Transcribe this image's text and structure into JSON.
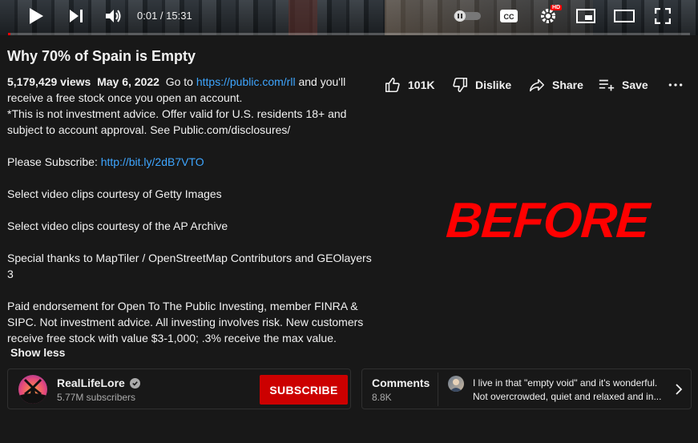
{
  "player": {
    "time": "0:01 / 15:31",
    "progress_fraction": 0.001,
    "hd_badge": "HD",
    "icons": [
      "play-icon",
      "next-icon",
      "volume-icon",
      "autoplay-toggle-icon",
      "captions-icon",
      "settings-icon",
      "miniplayer-icon",
      "theater-icon",
      "fullscreen-icon"
    ]
  },
  "video": {
    "title": "Why 70% of Spain is Empty"
  },
  "description": {
    "views": "5,179,429 views",
    "date": "May 6, 2022",
    "line1_pre": "Go to",
    "line1_link": "https://public.com/rll",
    "line1_post": "and you'll",
    "line2": "receive a free stock once you open an account.",
    "line3": "*This is not investment advice. Offer valid for U.S. residents 18+ and",
    "line4": "subject to account approval. See Public.com/disclosures/",
    "subscribe_pre": "Please Subscribe:",
    "subscribe_link": "http://bit.ly/2dB7VTO",
    "getty": "Select video clips courtesy of Getty Images",
    "ap": "Select video clips courtesy of the AP Archive",
    "thanks_line1": "Special thanks to MapTiler / OpenStreetMap Contributors and GEOlayers",
    "thanks_line2": "3",
    "paid_line1": "Paid endorsement for Open To The Public Investing, member FINRA &",
    "paid_line2": "SIPC. Not investment advice. All investing involves risk. New customers",
    "paid_line3": "receive free stock with value $3-1,000; .3% receive the max value.",
    "show_less": "Show less"
  },
  "actions": {
    "like_count": "101K",
    "dislike_label": "Dislike",
    "share_label": "Share",
    "save_label": "Save"
  },
  "overlay": {
    "before_text": "BEFORE",
    "color": "#ff0000"
  },
  "channel": {
    "name": "RealLifeLore",
    "subscribers": "5.77M subscribers",
    "subscribe_label": "SUBSCRIBE",
    "subscribe_color": "#cc0000"
  },
  "comments": {
    "label": "Comments",
    "count": "8.8K",
    "preview_line1": "I live in that \"empty void\" and it's wonderful.",
    "preview_line2": "Not overcrowded, quiet and relaxed and in..."
  },
  "colors": {
    "background": "#181818",
    "link": "#3ea6ff",
    "progress": "#ff0000"
  }
}
